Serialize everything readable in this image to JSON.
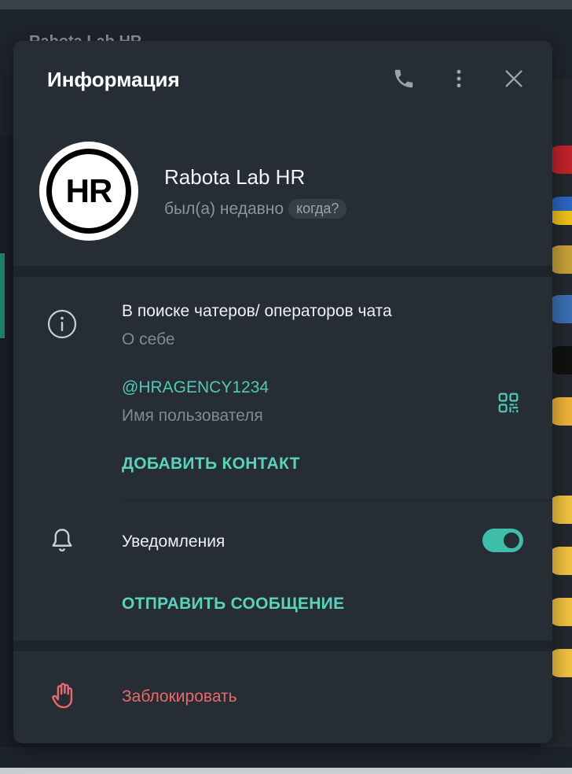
{
  "background": {
    "chat_title": "Rabota Lab HR"
  },
  "dialog": {
    "title": "Информация"
  },
  "profile": {
    "avatar_text": "HR",
    "name": "Rabota Lab HR",
    "status": "был(а) недавно",
    "when_badge": "когда?"
  },
  "info": {
    "bio": "В поиске чатеров/ операторов чата",
    "bio_label": "О себе",
    "username": "@HRAGENCY1234",
    "username_label": "Имя пользователя",
    "add_contact": "ДОБАВИТЬ КОНТАКТ"
  },
  "notifications": {
    "label": "Уведомления",
    "enabled": true,
    "send_message": "ОТПРАВИТЬ СООБЩЕНИЕ"
  },
  "block": {
    "label": "Заблокировать"
  },
  "colors": {
    "accent": "#5ad2bd",
    "danger": "#e8696b",
    "dialog_bg": "#272d35"
  }
}
